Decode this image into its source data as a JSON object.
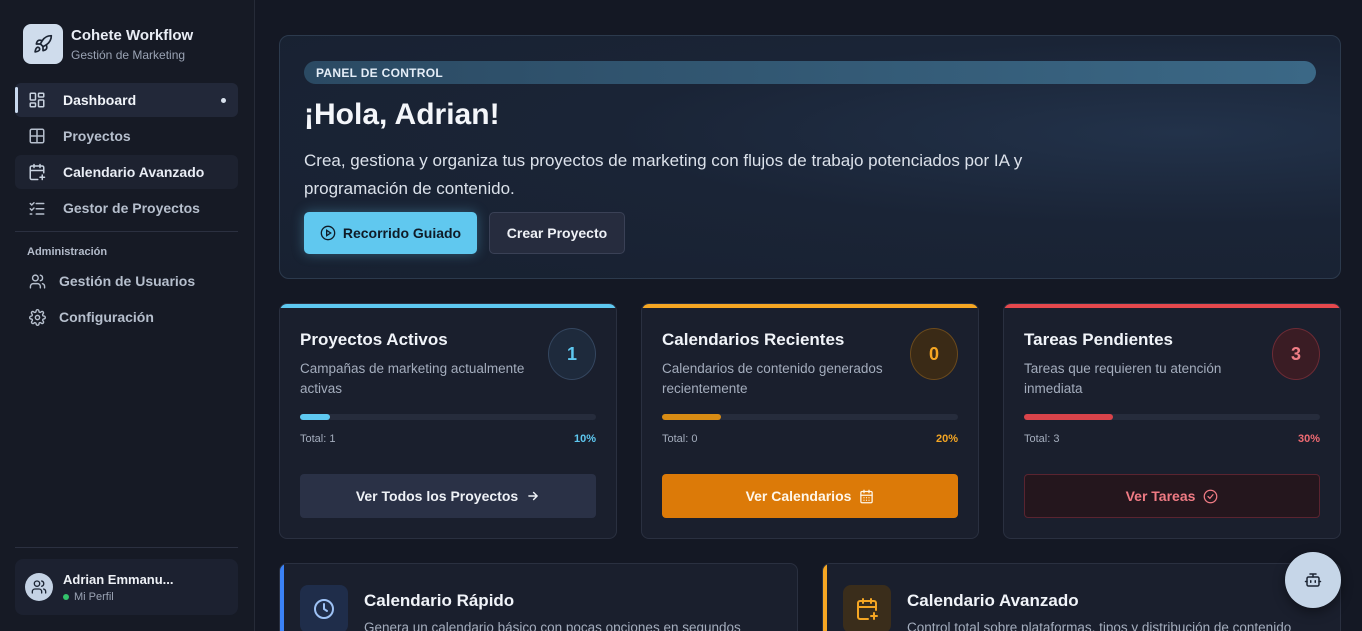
{
  "sidebar": {
    "brand_title": "Cohete Workflow",
    "brand_subtitle": "Gestión de Marketing",
    "items": [
      {
        "label": "Dashboard",
        "icon": "dashboard-icon",
        "active": true
      },
      {
        "label": "Proyectos",
        "icon": "grid-icon"
      },
      {
        "label": "Calendario Avanzado",
        "icon": "calendar-plus-icon"
      },
      {
        "label": "Gestor de Proyectos",
        "icon": "list-check-icon"
      }
    ],
    "admin_label": "Administración",
    "admin_items": [
      {
        "label": "Gestión de Usuarios",
        "icon": "users-icon"
      },
      {
        "label": "Configuración",
        "icon": "gear-icon"
      }
    ],
    "user": {
      "name": "Adrian Emmanu...",
      "status": "Mi Perfil"
    }
  },
  "hero": {
    "badge": "PANEL DE CONTROL",
    "title": "¡Hola, Adrian!",
    "description": "Crea, gestiona y organiza tus proyectos de marketing con flujos de trabajo potenciados por IA y programación de contenido.",
    "primary_button": "Recorrido Guiado",
    "secondary_button": "Crear Proyecto"
  },
  "stats": [
    {
      "title": "Proyectos Activos",
      "description": "Campañas de marketing actualmente activas",
      "count": "1",
      "total": "Total: 1",
      "percent": "10%",
      "progress": 0.1,
      "button": "Ver Todos los Proyectos",
      "color": "#5ec8f0"
    },
    {
      "title": "Calendarios Recientes",
      "description": "Calendarios de contenido generados recientemente",
      "count": "0",
      "total": "Total: 0",
      "percent": "20%",
      "progress": 0.2,
      "button": "Ver Calendarios",
      "color": "#f5a623"
    },
    {
      "title": "Tareas Pendientes",
      "description": "Tareas que requieren tu atención inmediata",
      "count": "3",
      "total": "Total: 3",
      "percent": "30%",
      "progress": 0.3,
      "button": "Ver Tareas",
      "color": "#e5484d"
    }
  ],
  "quick_cards": [
    {
      "title": "Calendario Rápido",
      "description": "Genera un calendario básico con pocas opciones en segundos",
      "icon": "clock-icon",
      "color": "#3b82f6"
    },
    {
      "title": "Calendario Avanzado",
      "description": "Control total sobre plataformas, tipos y distribución de contenido",
      "icon": "calendar-plus-icon",
      "color": "#f5a623"
    }
  ],
  "fab_icon": "bot-icon"
}
